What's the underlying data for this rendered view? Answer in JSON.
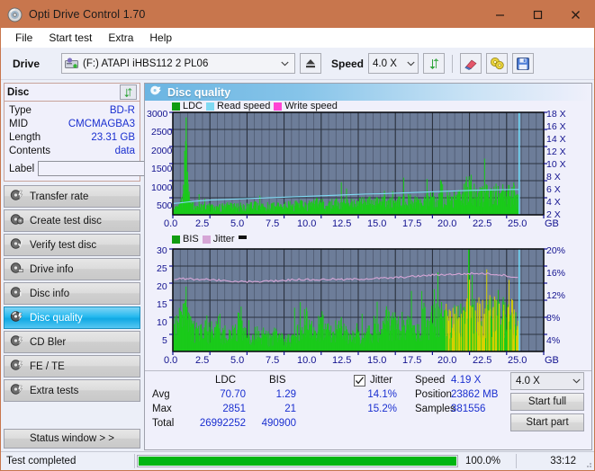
{
  "window": {
    "title": "Opti Drive Control 1.70",
    "icon": "disc-icon",
    "minimize": "minimize-icon",
    "maximize": "maximize-icon",
    "close": "close-icon"
  },
  "menu": {
    "items": [
      {
        "label": "File"
      },
      {
        "label": "Start test"
      },
      {
        "label": "Extra"
      },
      {
        "label": "Help"
      }
    ]
  },
  "toolbar": {
    "drive_label": "Drive",
    "drive_value": "(F:)  ATAPI iHBS112  2 PL06",
    "eject_icon": "eject-icon",
    "speed_label": "Speed",
    "speed_value": "4.0 X",
    "refresh_icon": "refresh-icon",
    "erase_icon": "eraser-icon",
    "disc_icon": "disc-tools-icon",
    "save_icon": "save-icon"
  },
  "disc": {
    "header": "Disc",
    "refresh_icon": "refresh-icon",
    "rows": [
      {
        "key": "Type",
        "value": "BD-R"
      },
      {
        "key": "MID",
        "value": "CMCMAGBA3"
      },
      {
        "key": "Length",
        "value": "23.31 GB"
      },
      {
        "key": "Contents",
        "value": "data"
      }
    ],
    "label_key": "Label",
    "label_value": "",
    "label_placeholder": "",
    "label_btn_icon": "disc-label-icon"
  },
  "nav": {
    "items": [
      {
        "label": "Transfer rate",
        "icon": "disc-rate-icon",
        "active": false
      },
      {
        "label": "Create test disc",
        "icon": "disc-create-icon",
        "active": false
      },
      {
        "label": "Verify test disc",
        "icon": "disc-verify-icon",
        "active": false
      },
      {
        "label": "Drive info",
        "icon": "drive-info-icon",
        "active": false
      },
      {
        "label": "Disc info",
        "icon": "disc-info-icon",
        "active": false
      },
      {
        "label": "Disc quality",
        "icon": "disc-quality-icon",
        "active": true
      },
      {
        "label": "CD Bler",
        "icon": "cd-bler-icon",
        "active": false
      },
      {
        "label": "FE / TE",
        "icon": "fe-te-icon",
        "active": false
      },
      {
        "label": "Extra tests",
        "icon": "extra-tests-icon",
        "active": false
      }
    ],
    "status_window": "Status window > >"
  },
  "panel": {
    "title": "Disc quality",
    "icon": "disc-quality-icon"
  },
  "stats": {
    "col_ldc": "LDC",
    "col_bis": "BIS",
    "jitter_label": "Jitter",
    "jitter_checked": true,
    "rows": [
      {
        "name": "Avg",
        "ldc": "70.70",
        "bis": "1.29",
        "jitter": "14.1%"
      },
      {
        "name": "Max",
        "ldc": "2851",
        "bis": "21",
        "jitter": "15.2%"
      },
      {
        "name": "Total",
        "ldc": "26992252",
        "bis": "490900",
        "jitter": ""
      }
    ],
    "speed_label": "Speed",
    "speed_value": "4.19 X",
    "position_label": "Position",
    "position_value": "23862 MB",
    "samples_label": "Samples",
    "samples_value": "381556",
    "speed_select": "4.0 X",
    "start_full": "Start full",
    "start_part": "Start part"
  },
  "statusbar": {
    "message": "Test completed",
    "percent": "100.0%",
    "percent_value": 100,
    "elapsed": "33:12"
  },
  "colors": {
    "titlebar": "#c8764d",
    "accent_blue": "#1a2fd0",
    "plot_bg": "#6d7d99",
    "ldc_green": "#1aca1a",
    "read_speed": "#7fd9f2",
    "write_speed": "#ff44d4",
    "jitter_pink": "#d6a6d6",
    "bis_yellow": "#dcd400",
    "progress_green": "#00b512",
    "nav_active": "#25b9ef"
  },
  "chart_data": [
    {
      "type": "area",
      "id": "ldc-chart",
      "title": "",
      "xlabel": "GB",
      "ylabel": "",
      "legend": [
        {
          "label": "LDC",
          "color": "#1aca1a"
        },
        {
          "label": "Read speed",
          "color": "#7fd9f2"
        },
        {
          "label": "Write speed",
          "color": "#ff44d4"
        }
      ],
      "legend_position": "top-left",
      "grid": true,
      "xlim": [
        0,
        25.0
      ],
      "xticks": [
        "0.0",
        "2.5",
        "5.0",
        "7.5",
        "10.0",
        "12.5",
        "15.0",
        "17.5",
        "20.0",
        "22.5",
        "25.0"
      ],
      "xunit": "GB",
      "ylim": [
        0,
        3000
      ],
      "yticks": [
        "3000",
        "2500",
        "2000",
        "1500",
        "1000",
        "500"
      ],
      "y2lim": [
        0,
        18
      ],
      "y2ticks": [
        "18 X",
        "16 X",
        "14 X",
        "12 X",
        "10 X",
        "8 X",
        "6 X",
        "4 X",
        "2 X"
      ],
      "series": [
        {
          "name": "LDC",
          "color": "#1aca1a",
          "kind": "spikes",
          "x": [
            0.1,
            0.3,
            0.5,
            0.7,
            0.9,
            1.0,
            1.1,
            1.3,
            1.5,
            1.8,
            2.0,
            2.3,
            2.6,
            3.0,
            3.4,
            3.8,
            4.2,
            4.6,
            5.0,
            5.5,
            6.0,
            6.5,
            7.0,
            7.5,
            8.0,
            8.5,
            9.0,
            9.5,
            10.0,
            10.5,
            11.0,
            11.5,
            12.0,
            12.5,
            13.0,
            13.5,
            14.0,
            14.5,
            15.0,
            15.5,
            16.0,
            16.5,
            17.0,
            17.5,
            18.0,
            18.5,
            19.0,
            19.5,
            20.0,
            20.3,
            20.6,
            21.0,
            21.4,
            21.8,
            22.2,
            22.6,
            23.0,
            23.3
          ],
          "y": [
            170,
            210,
            330,
            620,
            2851,
            1010,
            520,
            300,
            260,
            310,
            290,
            270,
            300,
            250,
            260,
            290,
            250,
            280,
            260,
            300,
            250,
            300,
            270,
            320,
            300,
            340,
            300,
            380,
            360,
            340,
            390,
            380,
            360,
            400,
            380,
            420,
            400,
            430,
            420,
            440,
            470,
            430,
            490,
            520,
            470,
            560,
            520,
            600,
            1010,
            700,
            640,
            780,
            700,
            820,
            700,
            760,
            700,
            430
          ]
        },
        {
          "name": "Read speed",
          "color": "#7fd9f2",
          "kind": "line",
          "x": [
            0.05,
            0.5,
            1.0,
            1.5,
            2.0,
            2.5,
            3.0,
            4.0,
            5.0,
            6.0,
            7.0,
            8.0,
            9.0,
            10.0,
            11.0,
            12.0,
            13.0,
            14.0,
            15.0,
            16.0,
            17.0,
            18.0,
            19.0,
            20.0,
            21.0,
            22.0,
            23.0,
            23.35,
            23.35
          ],
          "y_speed": [
            2.0,
            2.1,
            2.25,
            2.4,
            2.5,
            2.6,
            2.65,
            2.75,
            2.85,
            2.95,
            3.05,
            3.15,
            3.25,
            3.35,
            3.45,
            3.55,
            3.65,
            3.7,
            3.8,
            3.9,
            4.0,
            4.1,
            4.2,
            4.3,
            4.35,
            4.4,
            4.45,
            4.45,
            18.0
          ]
        }
      ]
    },
    {
      "type": "area",
      "id": "bis-jitter-chart",
      "title": "",
      "xlabel": "GB",
      "ylabel": "",
      "legend": [
        {
          "label": "BIS",
          "color": "#1aca1a"
        },
        {
          "label": "Jitter",
          "color": "#d6a6d6"
        }
      ],
      "legend_position": "top-left",
      "grid": true,
      "xlim": [
        0,
        25.0
      ],
      "xticks": [
        "0.0",
        "2.5",
        "5.0",
        "7.5",
        "10.0",
        "12.5",
        "15.0",
        "17.5",
        "20.0",
        "22.5",
        "25.0"
      ],
      "xunit": "GB",
      "ylim": [
        0,
        30
      ],
      "yticks": [
        "30",
        "25",
        "20",
        "15",
        "10",
        "5"
      ],
      "y2lim": [
        0,
        20
      ],
      "y2ticks": [
        "20%",
        "16%",
        "12%",
        "8%",
        "4%"
      ],
      "series": [
        {
          "name": "BIS",
          "color": "#1aca1a",
          "kind": "spikes",
          "x": [
            0.1,
            0.3,
            0.5,
            0.7,
            0.85,
            0.95,
            1.1,
            1.3,
            1.6,
            1.9,
            2.2,
            2.6,
            3.0,
            3.4,
            3.8,
            4.2,
            4.6,
            5.0,
            5.4,
            5.8,
            6.2,
            6.6,
            7.0,
            7.4,
            7.8,
            8.2,
            8.6,
            9.0,
            9.2,
            9.6,
            10.0,
            10.4,
            10.8,
            11.2,
            11.6,
            12.0,
            12.4,
            12.8,
            13.2,
            13.6,
            14.0,
            14.4,
            14.8,
            15.0,
            15.4,
            15.8,
            16.2,
            16.6,
            17.0,
            17.3,
            17.6,
            18.0,
            18.3,
            18.6,
            19.0,
            19.3,
            19.6,
            20.0,
            20.2,
            20.4,
            20.7,
            21.0,
            21.3,
            21.6,
            22.0,
            22.3,
            22.6,
            23.0,
            23.3
          ],
          "y": [
            8,
            9,
            12,
            14,
            15,
            13,
            11,
            8,
            7,
            6,
            9,
            5,
            8,
            6,
            5,
            7,
            10,
            4,
            5,
            6,
            5,
            4,
            6,
            5,
            4,
            5,
            7,
            11,
            8,
            6,
            10,
            7,
            5,
            9,
            6,
            5,
            7,
            4,
            6,
            8,
            5,
            12,
            9,
            10,
            6,
            8,
            7,
            6,
            13,
            9,
            11,
            10,
            12,
            9,
            11,
            10,
            12,
            21,
            13,
            12,
            14,
            11,
            12,
            13,
            14,
            12,
            13,
            11,
            9
          ]
        },
        {
          "name": "Jitter",
          "color": "#d6a6d6",
          "kind": "line",
          "x": [
            0.1,
            0.5,
            1.0,
            1.5,
            2.0,
            2.5,
            3.0,
            3.5,
            4.0,
            4.5,
            5.0,
            5.5,
            6.0,
            6.5,
            7.0,
            7.5,
            8.0,
            8.5,
            9.0,
            9.5,
            10.0,
            10.5,
            11.0,
            11.5,
            12.0,
            12.5,
            13.0,
            13.5,
            14.0,
            14.5,
            15.0,
            15.5,
            16.0,
            16.5,
            17.0,
            17.5,
            18.0,
            18.5,
            19.0,
            19.5,
            20.0,
            20.5,
            21.0,
            21.5,
            22.0,
            22.5,
            23.0,
            23.3
          ],
          "y_pct": [
            14.0,
            14.2,
            14.2,
            14.1,
            14.1,
            14.0,
            13.9,
            13.9,
            13.7,
            13.6,
            13.6,
            13.7,
            13.6,
            13.7,
            13.8,
            13.9,
            14.0,
            14.1,
            14.0,
            14.0,
            14.0,
            14.1,
            14.1,
            14.0,
            14.1,
            14.1,
            14.2,
            14.2,
            14.3,
            14.3,
            14.4,
            14.5,
            14.6,
            14.7,
            14.8,
            14.9,
            15.0,
            15.0,
            15.1,
            15.1,
            15.2,
            15.2,
            15.2,
            15.1,
            15.0,
            14.8,
            14.5,
            14.3
          ]
        }
      ]
    }
  ]
}
